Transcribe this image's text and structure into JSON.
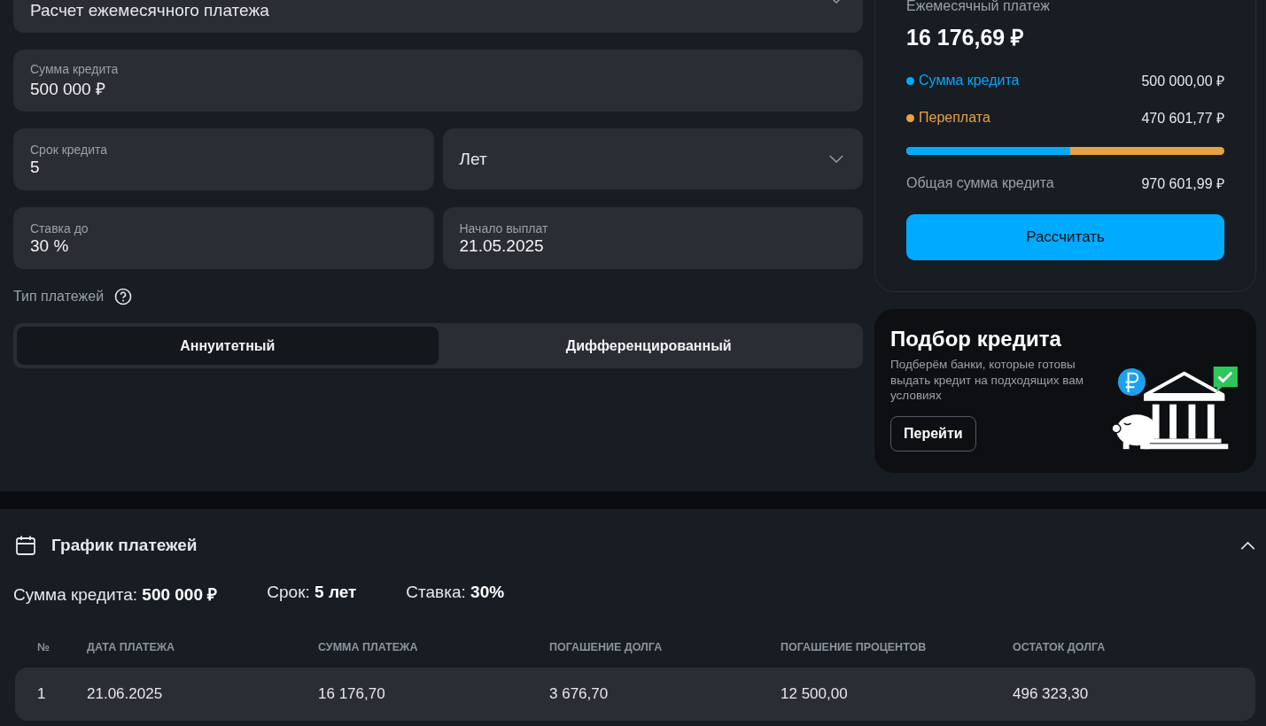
{
  "calculator": {
    "mode_select": {
      "value": "Расчет ежемесячного платежа"
    },
    "fields": [
      {
        "kind": "input",
        "label": "Сумма кредита",
        "value": "500 000 ₽"
      },
      {
        "kind": "input",
        "label": "Срок кредита",
        "value": "5"
      },
      {
        "kind": "select",
        "value": "Лет"
      },
      {
        "kind": "input",
        "label": "Ставка до",
        "value": "30 %"
      },
      {
        "kind": "input",
        "label": "Начало выплат",
        "value": "21.05.2025"
      }
    ],
    "payment_type": {
      "label": "Тип платежей",
      "options": [
        {
          "label": "Аннуитетный",
          "selected": true
        },
        {
          "label": "Дифференцированный",
          "selected": false
        }
      ]
    }
  },
  "summary": {
    "title": "Ежемесячный платеж",
    "amount": "16 176,69 ₽",
    "rows": [
      {
        "label": "Сумма кредита",
        "value": "500 000,00 ₽",
        "color": "#00aaff"
      },
      {
        "label": "Переплата",
        "value": "470 601,77 ₽",
        "color": "#e8a243"
      }
    ],
    "ratio_bar": {
      "level": 0.515
    },
    "total": {
      "label": "Общая сумма кредита",
      "value": "970 601,99 ₽"
    },
    "button": "Рассчитать"
  },
  "promo": {
    "title": "Подбор кредита",
    "text": "Подберём банки, которые готовы выдать кредит на подходящих вам условиях",
    "button": "Перейти"
  },
  "schedule": {
    "title": "График платежей",
    "expanded": true,
    "params": [
      {
        "label": "Сумма кредита:",
        "value": "500 000 ₽"
      },
      {
        "label": "Срок:",
        "value": "5 лет"
      },
      {
        "label": "Ставка:",
        "value": "30%"
      }
    ],
    "columns": [
      "№",
      "ДАТА ПЛАТЕЖА",
      "СУММА ПЛАТЕЖА",
      "ПОГАШЕНИЕ ДОЛГА",
      "ПОГАШЕНИЕ ПРОЦЕНТОВ",
      "ОСТАТОК ДОЛГА"
    ],
    "rows": [
      [
        "1",
        "21.06.2025",
        "16 176,70",
        "3 676,70",
        "12 500,00",
        "496 323,30"
      ]
    ]
  }
}
